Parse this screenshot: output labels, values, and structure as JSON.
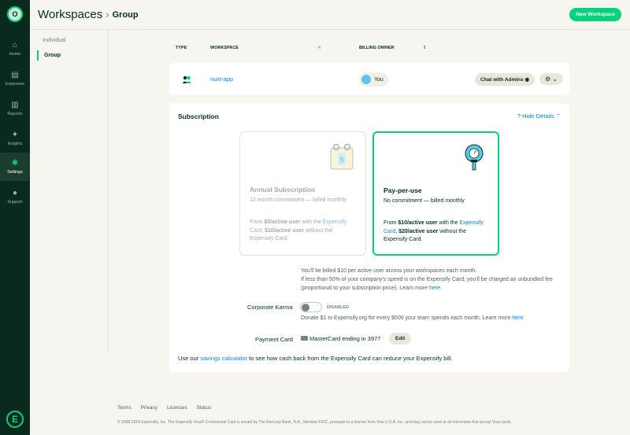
{
  "nav": {
    "avatar_initials": "O",
    "items": [
      {
        "label": "Home",
        "icon": "home-icon",
        "glyph": "⌂"
      },
      {
        "label": "Expenses",
        "icon": "receipt-icon",
        "glyph": "▤"
      },
      {
        "label": "Reports",
        "icon": "document-icon",
        "glyph": "▥"
      },
      {
        "label": "Insights",
        "icon": "lightbulb-icon",
        "glyph": "✦"
      },
      {
        "label": "Settings",
        "icon": "gear-icon",
        "glyph": "✱"
      },
      {
        "label": "Support",
        "icon": "chat-bubble-icon",
        "glyph": "●"
      }
    ],
    "active": "Settings",
    "logo": "E"
  },
  "header": {
    "title": "Workspaces",
    "separator": "›",
    "subtitle": "Group",
    "new_button": "New Workspace"
  },
  "subnav": {
    "items": [
      "Individual",
      "Group"
    ],
    "selected": "Group"
  },
  "table": {
    "columns": {
      "type": "TYPE",
      "workspace": "WORKSPACE",
      "owner": "BILLING OWNER"
    },
    "sort_up": "˄",
    "sort_both": "⇕",
    "rows": [
      {
        "workspace": "nuxt-app",
        "owner": "You",
        "chat": "Chat with Admins",
        "chat_glyph": "◉",
        "gear": "⚙ ⌄"
      }
    ]
  },
  "subscription": {
    "title": "Subscription",
    "hide_details": "Hide Details",
    "hide_glyph": "?",
    "hide_chevron": "⌃",
    "annual": {
      "title": "Annual Subscription",
      "desc": "12 month commitment — billed monthly",
      "price_pre": "From ",
      "price1": "$5/active user",
      "price_mid": " with the ",
      "link": "Expensify Card",
      "price_mid2": ", ",
      "price2": "$10/active user",
      "price_post": " without the Expensify Card."
    },
    "ppu": {
      "title": "Pay-per-use",
      "desc": "No commitment — billed monthly",
      "price_pre": "From ",
      "price1": "$10/active user",
      "price_mid": " with the ",
      "link": "Expensify Card",
      "price_mid2": ", ",
      "price2": "$20/active user",
      "price_post": " without the Expensify Card."
    },
    "info_1": "You'll be billed $10 per active user across your workspaces each month.",
    "info_2": "If less than 50% of your company's spend is on the Expensify Card, you'll be charged an unbundled fee (proportional to your subscription price). Learn more ",
    "info_link": "here",
    "info_end": ".",
    "karma_label": "Corporate Karma",
    "karma_status": "DISABLED",
    "donate_text": "Donate $1 to Expensify.org for every $500 your team spends each month. Learn more ",
    "donate_link": "here",
    "donate_end": ".",
    "payment_label": "Payment Card",
    "payment_value": "MasterCard ending in 3977",
    "edit": "Edit",
    "savings_pre": "Use our ",
    "savings_link": "savings calculator",
    "savings_post": " to see how cash back from the Expensify Card can reduce your Expensify bill."
  },
  "footer": {
    "links": [
      "Terms",
      "Privacy",
      "Licenses",
      "Status"
    ],
    "copyright": "© 2008-2024 Expensify, Inc. The Expensify Visa® Commercial Card is issued by The Bancorp Bank, N.A., Member FDIC, pursuant to a license from Visa U.S.A. Inc. and may not be used at all merchants that accept Visa cards."
  },
  "colors": {
    "accent": "#03d47c",
    "sidebar": "#0b2a1f",
    "link": "#0185ff",
    "background": "#f7f5ef"
  }
}
